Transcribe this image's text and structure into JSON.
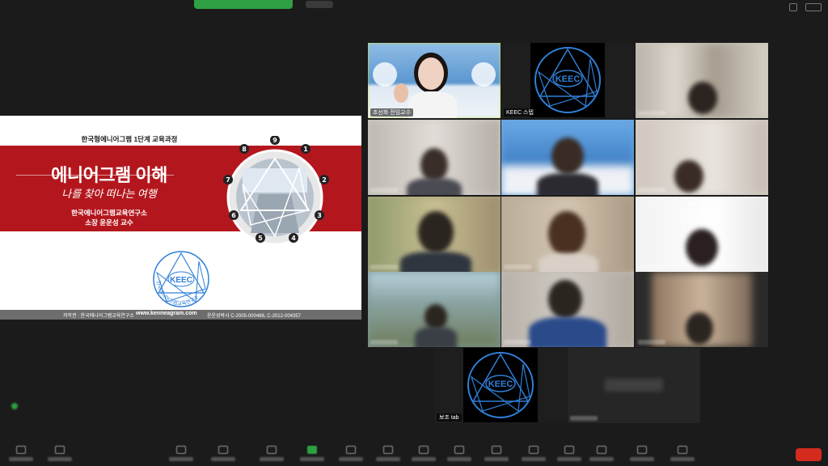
{
  "slide": {
    "course": "한국형에니어그램 1단계 교육과정",
    "title": "에니어그램 이해",
    "subtitle": "나를 찾아 떠나는 여행",
    "institute": "한국에니어그램교육연구소",
    "professor": "소장 윤운성 교수",
    "footer_copyright": "저작권 : 한국에니어그램교육연구소",
    "footer_url": "www.kenneagram.com",
    "footer_patent": "윤운성박사 C-2005-000486, C-2012-004357",
    "logo_text": "KEEC",
    "logo_ring": "한국에니어그램교육연구소",
    "wheel_numbers": [
      "9",
      "1",
      "2",
      "3",
      "4",
      "5",
      "6",
      "7",
      "8"
    ]
  },
  "tiles": {
    "presenter_name": "조선화 전임교수",
    "keec_name": "KEEC 스텝",
    "keec_logo_text": "KEEC",
    "aux_name": "보조 tab",
    "blank_name": "참가자"
  },
  "colors": {
    "banner_red": "#b3171d",
    "logo_blue": "#2f7fd6",
    "active_speaker": "#c9e63b",
    "end_button": "#d52b1e",
    "top_share_bar": "#2ea043"
  }
}
